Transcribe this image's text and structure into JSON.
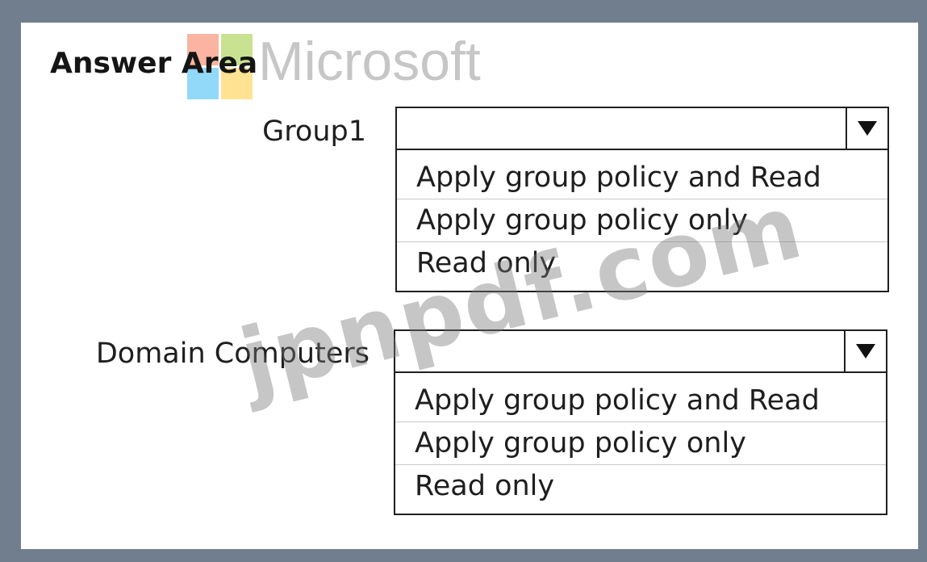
{
  "answer_area": {
    "title": "Answer Area"
  },
  "branding": {
    "logo_text": "Microsoft",
    "logo_icon": "microsoft-logo-icon",
    "logo_colors": [
      "#f25022",
      "#7fba00",
      "#00a4ef",
      "#ffb900"
    ],
    "watermark": "jpnpdf.com"
  },
  "rows": [
    {
      "label": "Group1",
      "selected": "",
      "options": [
        "Apply group policy and Read",
        "Apply group policy only",
        "Read only"
      ]
    },
    {
      "label": "Domain Computers",
      "selected": "",
      "options": [
        "Apply group policy and Read",
        "Apply group policy only",
        "Read only"
      ]
    }
  ],
  "icons": {
    "dropdown_arrow": "triangle-down-icon"
  },
  "colors": {
    "frame": "#717e8e",
    "panel": "#ffffff",
    "text": "#1e1e1e"
  }
}
